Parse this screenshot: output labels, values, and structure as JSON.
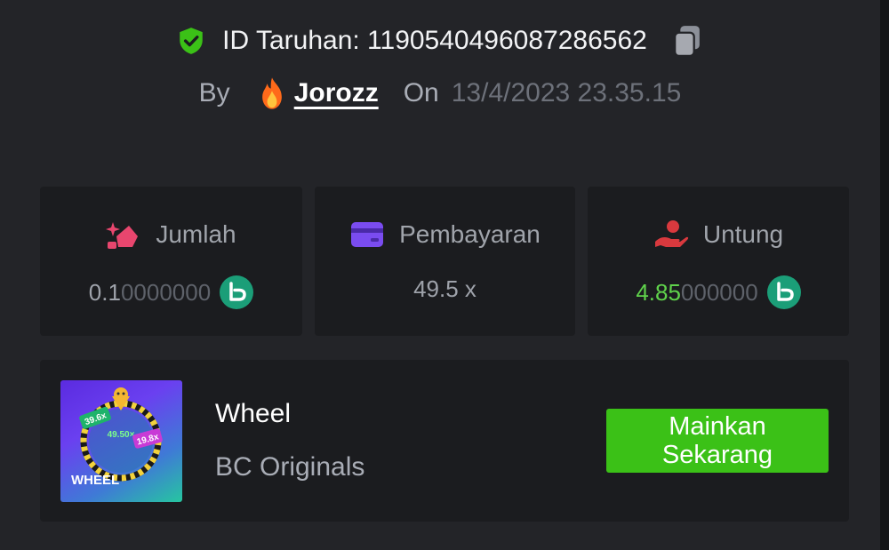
{
  "header": {
    "bet_id_label": "ID Taruhan: 1190540496087286562",
    "by_label": "By",
    "username": "Jorozz",
    "on_label": "On",
    "date": "13/4/2023 23.35.15"
  },
  "stats": {
    "amount": {
      "label": "Jumlah",
      "value_main": "0.1",
      "value_dim": "0000000",
      "currency_icon": "bc-coin-icon"
    },
    "payout": {
      "label": "Pembayaran",
      "value": "49.5 x"
    },
    "profit": {
      "label": "Untung",
      "value_main": "4.85",
      "value_dim": "000000",
      "currency_icon": "bc-coin-icon"
    }
  },
  "game": {
    "title": "Wheel",
    "provider": "BC Originals",
    "thumb_text": "WHEEL",
    "thumb_mult_center": "49.50×",
    "thumb_mult_left": "39.6x",
    "thumb_mult_right": "19.8x",
    "play_line1": "Mainkan",
    "play_line2": "Sekarang"
  },
  "colors": {
    "background": "#232428",
    "card": "#1b1c1f",
    "accent_green": "#3bc117",
    "profit_green": "#5fd24b",
    "icon_pink": "#e8466e",
    "icon_purple": "#7a4cf0",
    "icon_red": "#d9393e",
    "coin_teal": "#1b9e78"
  }
}
